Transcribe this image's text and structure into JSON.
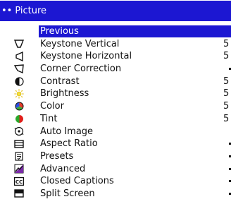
{
  "header": {
    "title": "Picture",
    "dots": "••"
  },
  "menu": {
    "items": [
      {
        "label": "Previous",
        "value": "",
        "icon": "none",
        "selected": true
      },
      {
        "label": "Keystone Vertical",
        "value": "5",
        "icon": "keystone-vertical-icon"
      },
      {
        "label": "Keystone Horizontal",
        "value": "5",
        "icon": "keystone-horizontal-icon"
      },
      {
        "label": "Corner Correction",
        "value": "",
        "icon": "corner-correction-icon"
      },
      {
        "label": "Contrast",
        "value": "5",
        "icon": "contrast-icon"
      },
      {
        "label": "Brightness",
        "value": "5",
        "icon": "brightness-icon"
      },
      {
        "label": "Color",
        "value": "5",
        "icon": "color-icon"
      },
      {
        "label": "Tint",
        "value": "5",
        "icon": "tint-icon"
      },
      {
        "label": "Auto Image",
        "value": "",
        "icon": "auto-image-icon"
      },
      {
        "label": "Aspect Ratio",
        "value": "",
        "icon": "aspect-ratio-icon"
      },
      {
        "label": "Presets",
        "value": "",
        "icon": "presets-icon"
      },
      {
        "label": "Advanced",
        "value": "",
        "icon": "advanced-icon"
      },
      {
        "label": "Closed Captions",
        "value": "",
        "icon": "closed-captions-icon"
      },
      {
        "label": "Split Screen",
        "value": "",
        "icon": "split-screen-icon"
      }
    ]
  },
  "colors": {
    "accent": "#1c17d2",
    "text": "#111111",
    "background": "#ffffff"
  }
}
